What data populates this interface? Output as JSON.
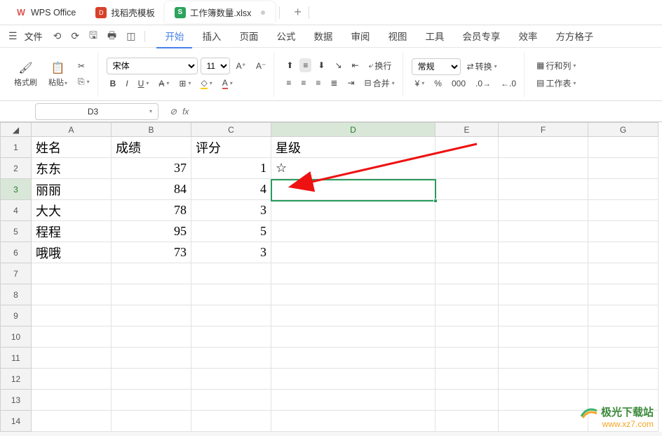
{
  "titlebar": {
    "app_name": "WPS Office",
    "tabs": [
      "找稻壳模板",
      "工作簿数量.xlsx"
    ],
    "add_label": "+"
  },
  "menu": {
    "file": "文件",
    "tabs": [
      "开始",
      "插入",
      "页面",
      "公式",
      "数据",
      "审阅",
      "视图",
      "工具",
      "会员专享",
      "效率",
      "方方格子"
    ],
    "active_index": 0
  },
  "ribbon": {
    "format_painter": "格式刷",
    "paste": "粘贴",
    "font_name": "宋体",
    "font_size": "11",
    "wrap": "换行",
    "merge": "合并",
    "general": "常规",
    "convert": "转换",
    "rowcol": "行和列",
    "worksheet": "工作表"
  },
  "namebox": {
    "ref": "D3",
    "fx": "fx"
  },
  "sheet": {
    "columns": [
      "A",
      "B",
      "C",
      "D",
      "E",
      "F",
      "G"
    ],
    "active_col": "D",
    "active_row": "3",
    "headers": {
      "A": "姓名",
      "B": "成绩",
      "C": "评分",
      "D": "星级"
    },
    "rows": [
      {
        "A": "东东",
        "B": "37",
        "C": "1",
        "D": "☆"
      },
      {
        "A": "丽丽",
        "B": "84",
        "C": "4",
        "D": ""
      },
      {
        "A": "大大",
        "B": "78",
        "C": "3",
        "D": ""
      },
      {
        "A": "程程",
        "B": "95",
        "C": "5",
        "D": ""
      },
      {
        "A": "哦哦",
        "B": "73",
        "C": "3",
        "D": ""
      }
    ]
  },
  "watermark": {
    "text": "极光下载站",
    "url": "www.xz7.com"
  }
}
